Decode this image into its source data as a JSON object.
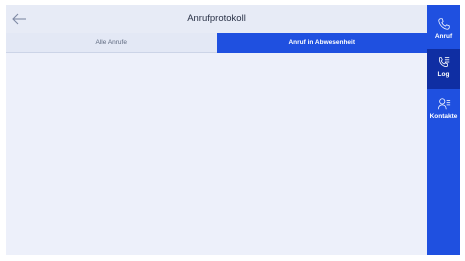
{
  "header": {
    "back_icon": "arrow-left-icon",
    "title": "Anrufprotokoll"
  },
  "tabs": [
    {
      "label": "Alle Anrufe",
      "active": false
    },
    {
      "label": "Anruf in Abwesenheit",
      "active": true
    }
  ],
  "nav": [
    {
      "label": "Anruf",
      "icon": "phone-icon",
      "active": false
    },
    {
      "label": "Log",
      "icon": "call-log-icon",
      "active": true
    },
    {
      "label": "Kontakte",
      "icon": "contacts-icon",
      "active": false
    }
  ],
  "colors": {
    "accent": "#1f50e0",
    "accent_active": "#0f2ea3",
    "background": "#edf0fa"
  }
}
